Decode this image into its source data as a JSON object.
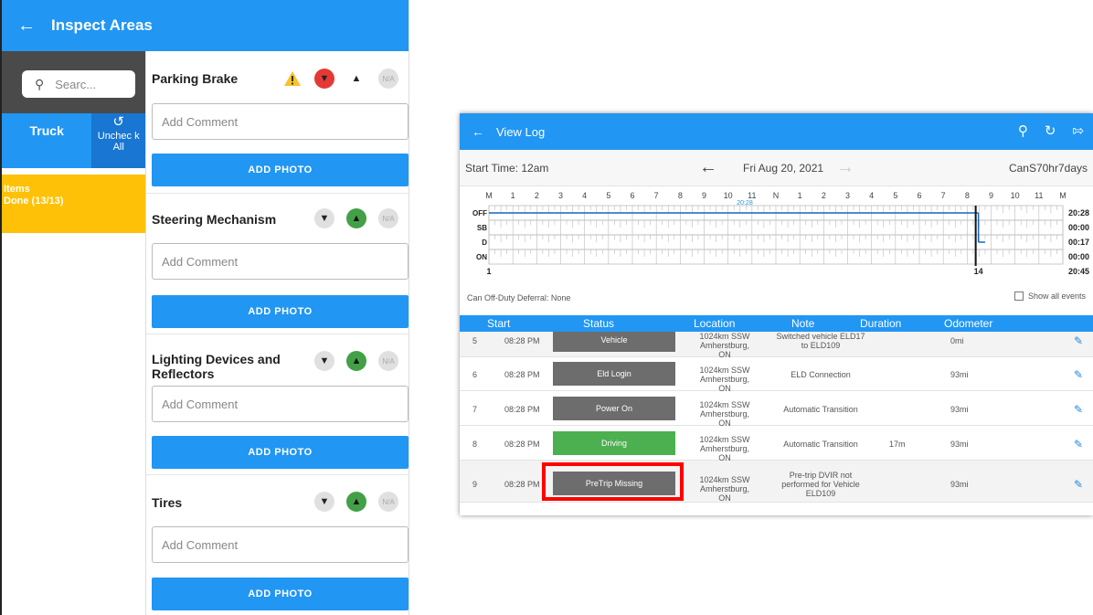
{
  "inspect": {
    "title": "Inspect Areas",
    "search_placeholder": "Searc...",
    "tab_truck": "Truck",
    "tab_uncheck": "Unchec k All",
    "items_line1": "Items",
    "items_line2": "Done (13/13)",
    "sections": [
      {
        "name": "Parking Brake",
        "comment": "Add Comment",
        "photo": "ADD PHOTO",
        "na": "N/A",
        "thumbs_down_active": true,
        "thumbs_up_active": false,
        "warning": true
      },
      {
        "name": "Steering Mechanism",
        "comment": "Add Comment",
        "photo": "ADD PHOTO",
        "na": "N/A",
        "thumbs_down_active": false,
        "thumbs_up_active": true,
        "warning": false
      },
      {
        "name": "Lighting Devices and Reflectors",
        "comment": "Add Comment",
        "photo": "ADD PHOTO",
        "na": "N/A",
        "thumbs_down_active": false,
        "thumbs_up_active": true,
        "warning": false
      },
      {
        "name": "Tires",
        "comment": "Add Comment",
        "photo": "ADD PHOTO",
        "na": "N/A",
        "thumbs_down_active": false,
        "thumbs_up_active": true,
        "warning": false
      }
    ]
  },
  "viewlog": {
    "title": "View Log",
    "start_time": "Start Time: 12am",
    "date": "Fri Aug 20, 2021",
    "cycle": "CanS70hr7days",
    "hours": [
      "M",
      "1",
      "2",
      "3",
      "4",
      "5",
      "6",
      "7",
      "8",
      "9",
      "10",
      "11",
      "N",
      "1",
      "2",
      "3",
      "4",
      "5",
      "6",
      "7",
      "8",
      "9",
      "10",
      "11",
      "M"
    ],
    "statuses": [
      "OFF",
      "SB",
      "D",
      "ON"
    ],
    "totals": [
      "20:28",
      "00:00",
      "00:17",
      "00:00",
      "20:45"
    ],
    "graph_start_label": "1",
    "graph_marker_label": "14",
    "graph_time_label": "20:28",
    "deferral": "Can Off-Duty Deferral: None",
    "show_all": "Show all events",
    "columns": [
      "Start",
      "Status",
      "Location",
      "Note",
      "Duration",
      "Odometer"
    ],
    "rows": [
      {
        "num": "5",
        "time": "08:28 PM",
        "status": "Vehicle",
        "loc1": "1024km SSW",
        "loc2": "Amherstburg, ON",
        "note1": "Switched vehicle ELD17",
        "note2": "to ELD109",
        "note3": "",
        "duration": "",
        "odometer": "0mi",
        "green": false
      },
      {
        "num": "6",
        "time": "08:28 PM",
        "status": "Eld Login",
        "loc1": "1024km SSW",
        "loc2": "Amherstburg, ON",
        "note1": "ELD Connection",
        "note2": "",
        "note3": "",
        "duration": "",
        "odometer": "93mi",
        "green": false
      },
      {
        "num": "7",
        "time": "08:28 PM",
        "status": "Power On",
        "loc1": "1024km SSW",
        "loc2": "Amherstburg, ON",
        "note1": "Automatic Transition",
        "note2": "",
        "note3": "",
        "duration": "",
        "odometer": "93mi",
        "green": false
      },
      {
        "num": "8",
        "time": "08:28 PM",
        "status": "Driving",
        "loc1": "1024km SSW",
        "loc2": "Amherstburg, ON",
        "note1": "Automatic Transition",
        "note2": "",
        "note3": "",
        "duration": "17m",
        "odometer": "93mi",
        "green": true
      },
      {
        "num": "9",
        "time": "08:28 PM",
        "status": "PreTrip Missing",
        "loc1": "1024km SSW",
        "loc2": "Amherstburg, ON",
        "note1": "Pre-trip DVIR not",
        "note2": "performed for Vehicle",
        "note3": "ELD109",
        "duration": "",
        "odometer": "93mi",
        "green": false
      }
    ]
  },
  "colors": {
    "accent": "#2196f3",
    "items_done": "#ffc107",
    "driving": "#4caf50",
    "thumbs_down": "#e53935",
    "thumbs_up": "#43a047",
    "highlight": "#ff0000"
  }
}
